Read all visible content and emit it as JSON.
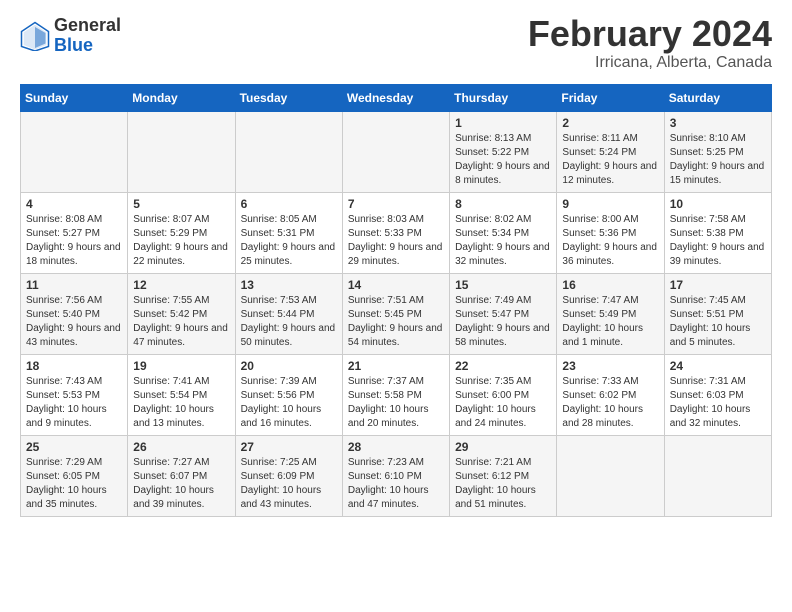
{
  "header": {
    "logo_general": "General",
    "logo_blue": "Blue",
    "month_title": "February 2024",
    "location": "Irricana, Alberta, Canada"
  },
  "weekdays": [
    "Sunday",
    "Monday",
    "Tuesday",
    "Wednesday",
    "Thursday",
    "Friday",
    "Saturday"
  ],
  "weeks": [
    [
      {
        "day": "",
        "sunrise": "",
        "sunset": "",
        "daylight": ""
      },
      {
        "day": "",
        "sunrise": "",
        "sunset": "",
        "daylight": ""
      },
      {
        "day": "",
        "sunrise": "",
        "sunset": "",
        "daylight": ""
      },
      {
        "day": "",
        "sunrise": "",
        "sunset": "",
        "daylight": ""
      },
      {
        "day": "1",
        "sunrise": "Sunrise: 8:13 AM",
        "sunset": "Sunset: 5:22 PM",
        "daylight": "Daylight: 9 hours and 8 minutes."
      },
      {
        "day": "2",
        "sunrise": "Sunrise: 8:11 AM",
        "sunset": "Sunset: 5:24 PM",
        "daylight": "Daylight: 9 hours and 12 minutes."
      },
      {
        "day": "3",
        "sunrise": "Sunrise: 8:10 AM",
        "sunset": "Sunset: 5:25 PM",
        "daylight": "Daylight: 9 hours and 15 minutes."
      }
    ],
    [
      {
        "day": "4",
        "sunrise": "Sunrise: 8:08 AM",
        "sunset": "Sunset: 5:27 PM",
        "daylight": "Daylight: 9 hours and 18 minutes."
      },
      {
        "day": "5",
        "sunrise": "Sunrise: 8:07 AM",
        "sunset": "Sunset: 5:29 PM",
        "daylight": "Daylight: 9 hours and 22 minutes."
      },
      {
        "day": "6",
        "sunrise": "Sunrise: 8:05 AM",
        "sunset": "Sunset: 5:31 PM",
        "daylight": "Daylight: 9 hours and 25 minutes."
      },
      {
        "day": "7",
        "sunrise": "Sunrise: 8:03 AM",
        "sunset": "Sunset: 5:33 PM",
        "daylight": "Daylight: 9 hours and 29 minutes."
      },
      {
        "day": "8",
        "sunrise": "Sunrise: 8:02 AM",
        "sunset": "Sunset: 5:34 PM",
        "daylight": "Daylight: 9 hours and 32 minutes."
      },
      {
        "day": "9",
        "sunrise": "Sunrise: 8:00 AM",
        "sunset": "Sunset: 5:36 PM",
        "daylight": "Daylight: 9 hours and 36 minutes."
      },
      {
        "day": "10",
        "sunrise": "Sunrise: 7:58 AM",
        "sunset": "Sunset: 5:38 PM",
        "daylight": "Daylight: 9 hours and 39 minutes."
      }
    ],
    [
      {
        "day": "11",
        "sunrise": "Sunrise: 7:56 AM",
        "sunset": "Sunset: 5:40 PM",
        "daylight": "Daylight: 9 hours and 43 minutes."
      },
      {
        "day": "12",
        "sunrise": "Sunrise: 7:55 AM",
        "sunset": "Sunset: 5:42 PM",
        "daylight": "Daylight: 9 hours and 47 minutes."
      },
      {
        "day": "13",
        "sunrise": "Sunrise: 7:53 AM",
        "sunset": "Sunset: 5:44 PM",
        "daylight": "Daylight: 9 hours and 50 minutes."
      },
      {
        "day": "14",
        "sunrise": "Sunrise: 7:51 AM",
        "sunset": "Sunset: 5:45 PM",
        "daylight": "Daylight: 9 hours and 54 minutes."
      },
      {
        "day": "15",
        "sunrise": "Sunrise: 7:49 AM",
        "sunset": "Sunset: 5:47 PM",
        "daylight": "Daylight: 9 hours and 58 minutes."
      },
      {
        "day": "16",
        "sunrise": "Sunrise: 7:47 AM",
        "sunset": "Sunset: 5:49 PM",
        "daylight": "Daylight: 10 hours and 1 minute."
      },
      {
        "day": "17",
        "sunrise": "Sunrise: 7:45 AM",
        "sunset": "Sunset: 5:51 PM",
        "daylight": "Daylight: 10 hours and 5 minutes."
      }
    ],
    [
      {
        "day": "18",
        "sunrise": "Sunrise: 7:43 AM",
        "sunset": "Sunset: 5:53 PM",
        "daylight": "Daylight: 10 hours and 9 minutes."
      },
      {
        "day": "19",
        "sunrise": "Sunrise: 7:41 AM",
        "sunset": "Sunset: 5:54 PM",
        "daylight": "Daylight: 10 hours and 13 minutes."
      },
      {
        "day": "20",
        "sunrise": "Sunrise: 7:39 AM",
        "sunset": "Sunset: 5:56 PM",
        "daylight": "Daylight: 10 hours and 16 minutes."
      },
      {
        "day": "21",
        "sunrise": "Sunrise: 7:37 AM",
        "sunset": "Sunset: 5:58 PM",
        "daylight": "Daylight: 10 hours and 20 minutes."
      },
      {
        "day": "22",
        "sunrise": "Sunrise: 7:35 AM",
        "sunset": "Sunset: 6:00 PM",
        "daylight": "Daylight: 10 hours and 24 minutes."
      },
      {
        "day": "23",
        "sunrise": "Sunrise: 7:33 AM",
        "sunset": "Sunset: 6:02 PM",
        "daylight": "Daylight: 10 hours and 28 minutes."
      },
      {
        "day": "24",
        "sunrise": "Sunrise: 7:31 AM",
        "sunset": "Sunset: 6:03 PM",
        "daylight": "Daylight: 10 hours and 32 minutes."
      }
    ],
    [
      {
        "day": "25",
        "sunrise": "Sunrise: 7:29 AM",
        "sunset": "Sunset: 6:05 PM",
        "daylight": "Daylight: 10 hours and 35 minutes."
      },
      {
        "day": "26",
        "sunrise": "Sunrise: 7:27 AM",
        "sunset": "Sunset: 6:07 PM",
        "daylight": "Daylight: 10 hours and 39 minutes."
      },
      {
        "day": "27",
        "sunrise": "Sunrise: 7:25 AM",
        "sunset": "Sunset: 6:09 PM",
        "daylight": "Daylight: 10 hours and 43 minutes."
      },
      {
        "day": "28",
        "sunrise": "Sunrise: 7:23 AM",
        "sunset": "Sunset: 6:10 PM",
        "daylight": "Daylight: 10 hours and 47 minutes."
      },
      {
        "day": "29",
        "sunrise": "Sunrise: 7:21 AM",
        "sunset": "Sunset: 6:12 PM",
        "daylight": "Daylight: 10 hours and 51 minutes."
      },
      {
        "day": "",
        "sunrise": "",
        "sunset": "",
        "daylight": ""
      },
      {
        "day": "",
        "sunrise": "",
        "sunset": "",
        "daylight": ""
      }
    ]
  ]
}
